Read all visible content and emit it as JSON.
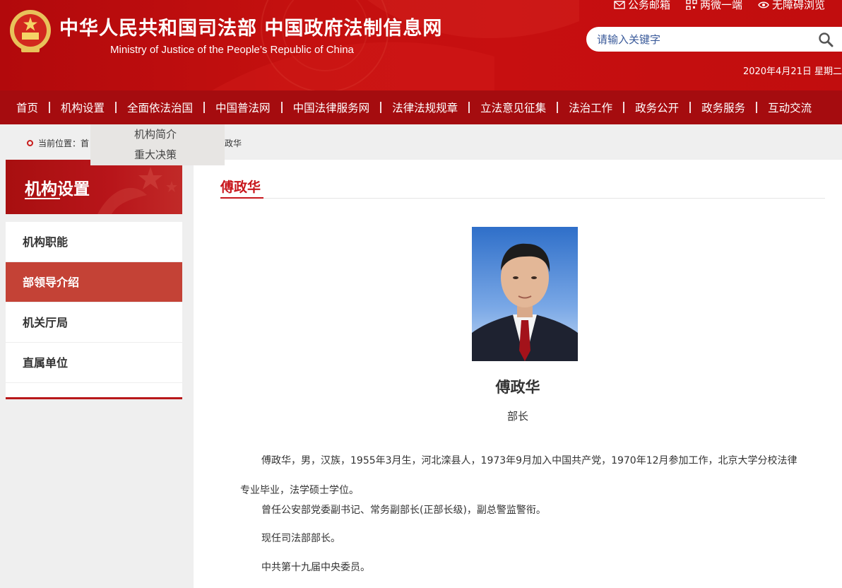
{
  "header": {
    "title": "中华人民共和国司法部  中国政府法制信息网",
    "subtitle": "Ministry of Justice of the People’s Republic of China",
    "links": [
      {
        "icon": "mail-icon",
        "label": "公务邮箱"
      },
      {
        "icon": "qrcode-icon",
        "label": "两微一端"
      },
      {
        "icon": "eye-icon",
        "label": "无障碍浏览"
      }
    ],
    "search_placeholder": "请输入关键字",
    "date": "2020年4月21日 星期二"
  },
  "nav": {
    "items": [
      "首页",
      "机构设置",
      "全面依法治国",
      "中国普法网",
      "中国法律服务网",
      "法律法规规章",
      "立法意见征集",
      "法治工作",
      "政务公开",
      "政务服务",
      "互动交流"
    ]
  },
  "dropdown": {
    "items": [
      "机构简介",
      "重大决策"
    ]
  },
  "breadcrumb": {
    "label": "当前位置：",
    "first": "首",
    "tail": "政华"
  },
  "sidebar": {
    "title": "机构设置",
    "items": [
      {
        "label": "机构职能",
        "active": false
      },
      {
        "label": "部领导介绍",
        "active": true
      },
      {
        "label": "机关厅局",
        "active": false
      },
      {
        "label": "直属单位",
        "active": false
      }
    ]
  },
  "content": {
    "title": "傅政华",
    "name": "傅政华",
    "role": "部长",
    "paragraphs": [
      "傅政华，男，汉族，1955年3月生，河北滦县人，1973年9月加入中国共产党，1970年12月参加工作，北京大学分校法律专业毕业，法学硕士学位。",
      "曾任公安部党委副书记、常务副部长(正部长级)，副总警监警衔。",
      "现任司法部部长。",
      "中共第十九届中央委员。"
    ]
  },
  "colors": {
    "header_red": "#c4100f",
    "nav_red": "#a50c0f",
    "active_item": "#c44236",
    "title_red": "#c8161c"
  }
}
